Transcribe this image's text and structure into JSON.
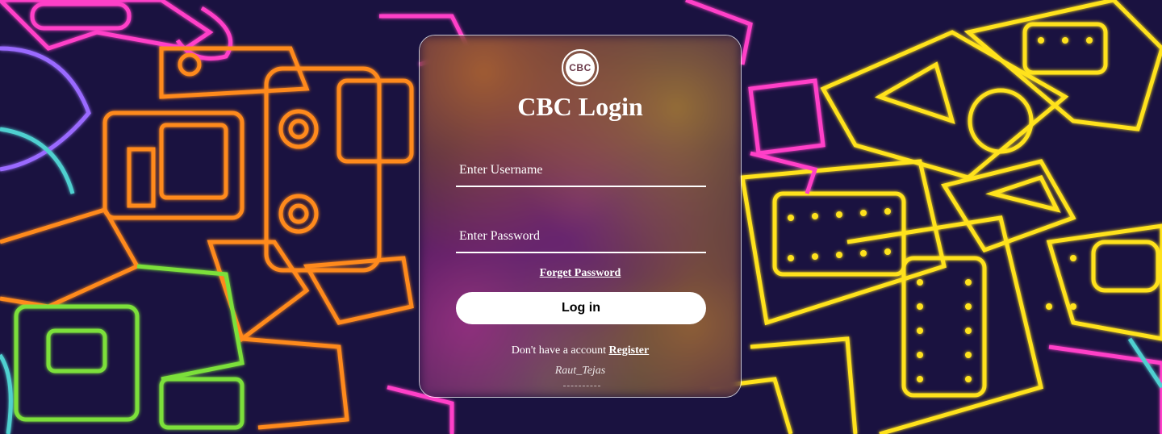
{
  "login": {
    "logo_text": "CBC",
    "title": "CBC Login",
    "username_placeholder": "Enter Username",
    "password_placeholder": "Enter Password",
    "forget_password": "Forget Password",
    "login_button": "Log in",
    "no_account_text": "Don't have a account",
    "register_link": "Register",
    "signature": "Raut_Tejas"
  },
  "colors": {
    "button_bg": "#ffffff",
    "text": "#ffffff",
    "background_dark": "#1a1240",
    "neon_orange": "#ff8a1f",
    "neon_yellow": "#ffe21f",
    "neon_pink": "#ff3fc8",
    "neon_green": "#7be03a"
  }
}
